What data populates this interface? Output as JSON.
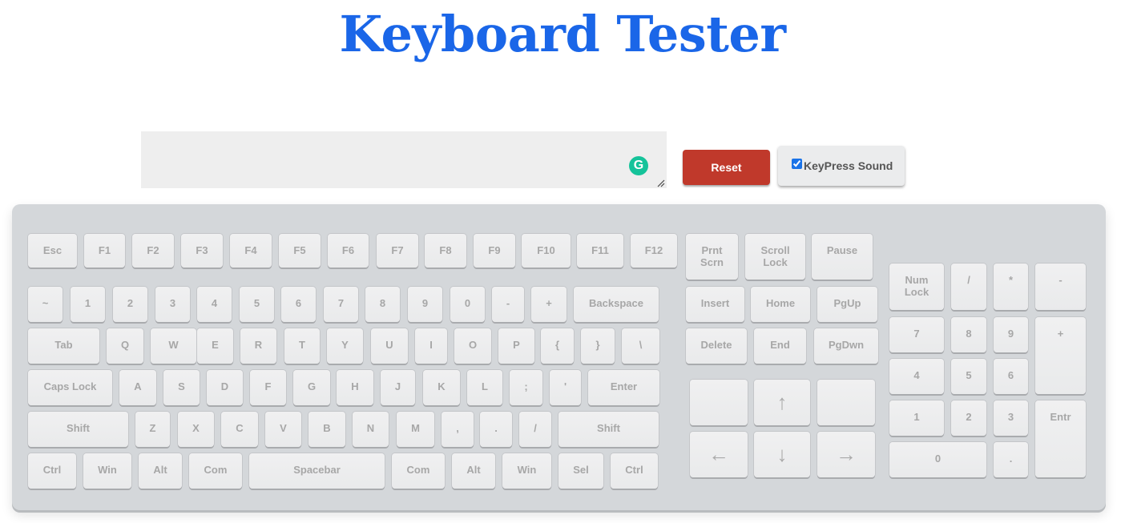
{
  "title": "Keyboard Tester",
  "textarea": {
    "value": "",
    "placeholder": ""
  },
  "grammarly_icon": "G",
  "buttons": {
    "reset": "Reset",
    "keypress_sound": "KeyPress Sound",
    "keypress_sound_checked": true
  },
  "colors": {
    "title": "#1a66e8",
    "reset": "#c0392b",
    "keyboard": "#d4d7da",
    "key": "#eeeff0",
    "key_text": "#a7a7a7"
  },
  "keys": {
    "function_row": [
      "Esc",
      "F1",
      "F2",
      "F3",
      "F4",
      "F5",
      "F6",
      "F7",
      "F8",
      "F9",
      "F10",
      "F11",
      "F12"
    ],
    "system": [
      "Prnt\nScrn",
      "Scroll\nLock",
      "Pause"
    ],
    "number_row": [
      "~",
      "1",
      "2",
      "3",
      "4",
      "5",
      "6",
      "7",
      "8",
      "9",
      "0",
      "-",
      "+",
      "Backspace"
    ],
    "qwerty_row": [
      "Tab",
      "Q",
      "W",
      "E",
      "R",
      "T",
      "Y",
      "U",
      "I",
      "O",
      "P",
      "{",
      "}",
      "\\"
    ],
    "home_row": [
      "Caps Lock",
      "A",
      "S",
      "D",
      "F",
      "G",
      "H",
      "J",
      "K",
      "L",
      ";",
      "'",
      "Enter"
    ],
    "shift_row": [
      "Shift",
      "Z",
      "X",
      "C",
      "V",
      "B",
      "N",
      "M",
      ",",
      ".",
      "/",
      "Shift"
    ],
    "bottom_row": [
      "Ctrl",
      "Win",
      "Alt",
      "Com",
      "Spacebar",
      "Com",
      "Alt",
      "Win",
      "Sel",
      "Ctrl"
    ],
    "nav": [
      "Insert",
      "Home",
      "PgUp",
      "Delete",
      "End",
      "PgDwn"
    ],
    "arrows": [
      "",
      "↑",
      "",
      "←",
      "↓",
      "→"
    ],
    "numpad": [
      "Num\nLock",
      "/",
      "*",
      "-",
      "7",
      "8",
      "9",
      "+",
      "4",
      "5",
      "6",
      "1",
      "2",
      "3",
      "Entr",
      "0",
      "."
    ]
  }
}
